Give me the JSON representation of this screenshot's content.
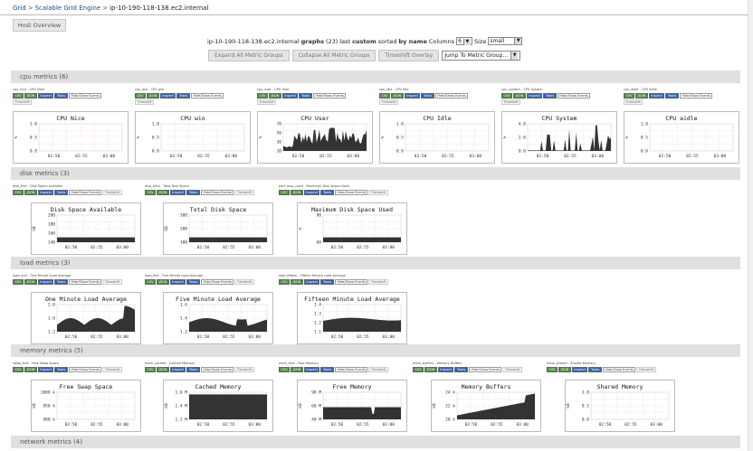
{
  "breadcrumb": {
    "grid": "Grid",
    "engine": "Scalable Grid Engine",
    "host": "ip-10-190-118-138.ec2.internal",
    "sep": ">"
  },
  "host_overview_label": "Host Overview",
  "info": {
    "host": "ip-10-190-118-138.ec2.internal",
    "graphs_word": "graphs",
    "count": "(23)",
    "last": "last",
    "custom": "custom",
    "sorted_by": "sorted",
    "by_name": "by name",
    "columns_label": "Columns",
    "columns_value": "6",
    "size_label": "Size",
    "size_value": "small"
  },
  "buttons": {
    "expand": "Expand All Metric Groups",
    "collapse": "Collapse All Metric Groups",
    "timeshift": "Timeshift Overlay",
    "jump": "Jump To Metric Group..."
  },
  "tool_labels": {
    "csv": "CSV",
    "json": "JSON",
    "inspect": "Inspect",
    "tasks": "Tasks",
    "hide": "Hide/Show Events",
    "timeshift": "Timeshift"
  },
  "x_ticks": [
    "02:50",
    "02:55",
    "03:00"
  ],
  "groups": [
    {
      "title": "cpu metrics (6)",
      "graphs": [
        {
          "small": "cpu_nice - CPU Nice",
          "title": "CPU Nice",
          "yticks": [
            "1.0",
            "0.5",
            "0.0"
          ],
          "unit": "%",
          "shape": "flat"
        },
        {
          "small": "cpu_wio - CPU wio",
          "title": "CPU wio",
          "yticks": [
            "1.0",
            "0.5",
            "0.0"
          ],
          "unit": "%",
          "shape": "flat"
        },
        {
          "small": "cpu_user - CPU User",
          "title": "CPU User",
          "yticks": [
            "70",
            "50",
            "30",
            "10"
          ],
          "unit": "%",
          "shape": "user"
        },
        {
          "small": "cpu_idle - CPU Idle",
          "title": "CPU Idle",
          "yticks": [
            "1.0",
            "0.5",
            "0.0"
          ],
          "unit": "%",
          "shape": "flat"
        },
        {
          "small": "cpu_system - CPU System",
          "title": "CPU System",
          "yticks": [
            "4.0",
            "2.0",
            "0.0"
          ],
          "unit": "%",
          "shape": "system"
        },
        {
          "small": "cpu_aidle - CPU aidle",
          "title": "CPU aidle",
          "yticks": [
            "1.0",
            "0.5",
            "0.0"
          ],
          "unit": "%",
          "shape": "flat"
        }
      ]
    },
    {
      "title": "disk metrics (3)",
      "graphs": [
        {
          "small": "disk_free - Disk Space Available",
          "title": "Disk Space Available",
          "yticks": [
            "200",
            "180",
            "160",
            "140"
          ],
          "unit": "GB",
          "shape": "lowband"
        },
        {
          "small": "disk_total - Total Disk Space",
          "title": "Total Disk Space",
          "yticks": [
            "300",
            "200",
            "100"
          ],
          "unit": "GB",
          "shape": "lowband"
        },
        {
          "small": "part_max_used - Maximum Disk Space Used",
          "title": "Maximum Disk Space Used",
          "yticks": [
            "90",
            "60"
          ],
          "unit": "%",
          "shape": "lowband"
        }
      ]
    },
    {
      "title": "load metrics (3)",
      "graphs": [
        {
          "small": "load_one - One Minute Load Average",
          "title": "One Minute Load Average",
          "yticks": [
            "2.0",
            "1.6",
            "1.2"
          ],
          "unit": "",
          "shape": "load1"
        },
        {
          "small": "load_five - Five Minute Load Average",
          "title": "Five Minute Load Average",
          "yticks": [
            "1.6",
            "1.4",
            "1.2"
          ],
          "unit": "",
          "shape": "load5"
        },
        {
          "small": "load_fifteen - Fifteen Minute Load Average",
          "title": "Fifteen Minute Load Average",
          "yticks": [
            "1.4",
            "1.3",
            "1.2",
            "1.1"
          ],
          "unit": "",
          "shape": "load15"
        }
      ]
    },
    {
      "title": "memory metrics (5)",
      "graphs": [
        {
          "small": "swap_free - Free Swap Space",
          "title": "Free Swap Space",
          "yticks": [
            "1000 k",
            "950 k",
            "900 k"
          ],
          "unit": "kB",
          "shape": "flat"
        },
        {
          "small": "mem_cached - Cached Memory",
          "title": "Cached Memory",
          "yticks": [
            "1.6 M",
            "1.4 M",
            "1.2 M"
          ],
          "unit": "kB",
          "shape": "full"
        },
        {
          "small": "mem_free - Free Memory",
          "title": "Free Memory",
          "yticks": [
            "90 M",
            "60 M",
            "40 M"
          ],
          "unit": "kB",
          "shape": "freemem"
        },
        {
          "small": "mem_buffers - Memory Buffers",
          "title": "Memory Buffers",
          "yticks": [
            "24 k",
            "22 k",
            "20 k"
          ],
          "unit": "kB",
          "shape": "buffers"
        },
        {
          "small": "mem_shared - Shared Memory",
          "title": "Shared Memory",
          "yticks": [
            "1.0",
            "0.5",
            "0.0"
          ],
          "unit": "kB",
          "shape": "flat"
        }
      ]
    },
    {
      "title": "network metrics (4)",
      "graphs": []
    }
  ]
}
